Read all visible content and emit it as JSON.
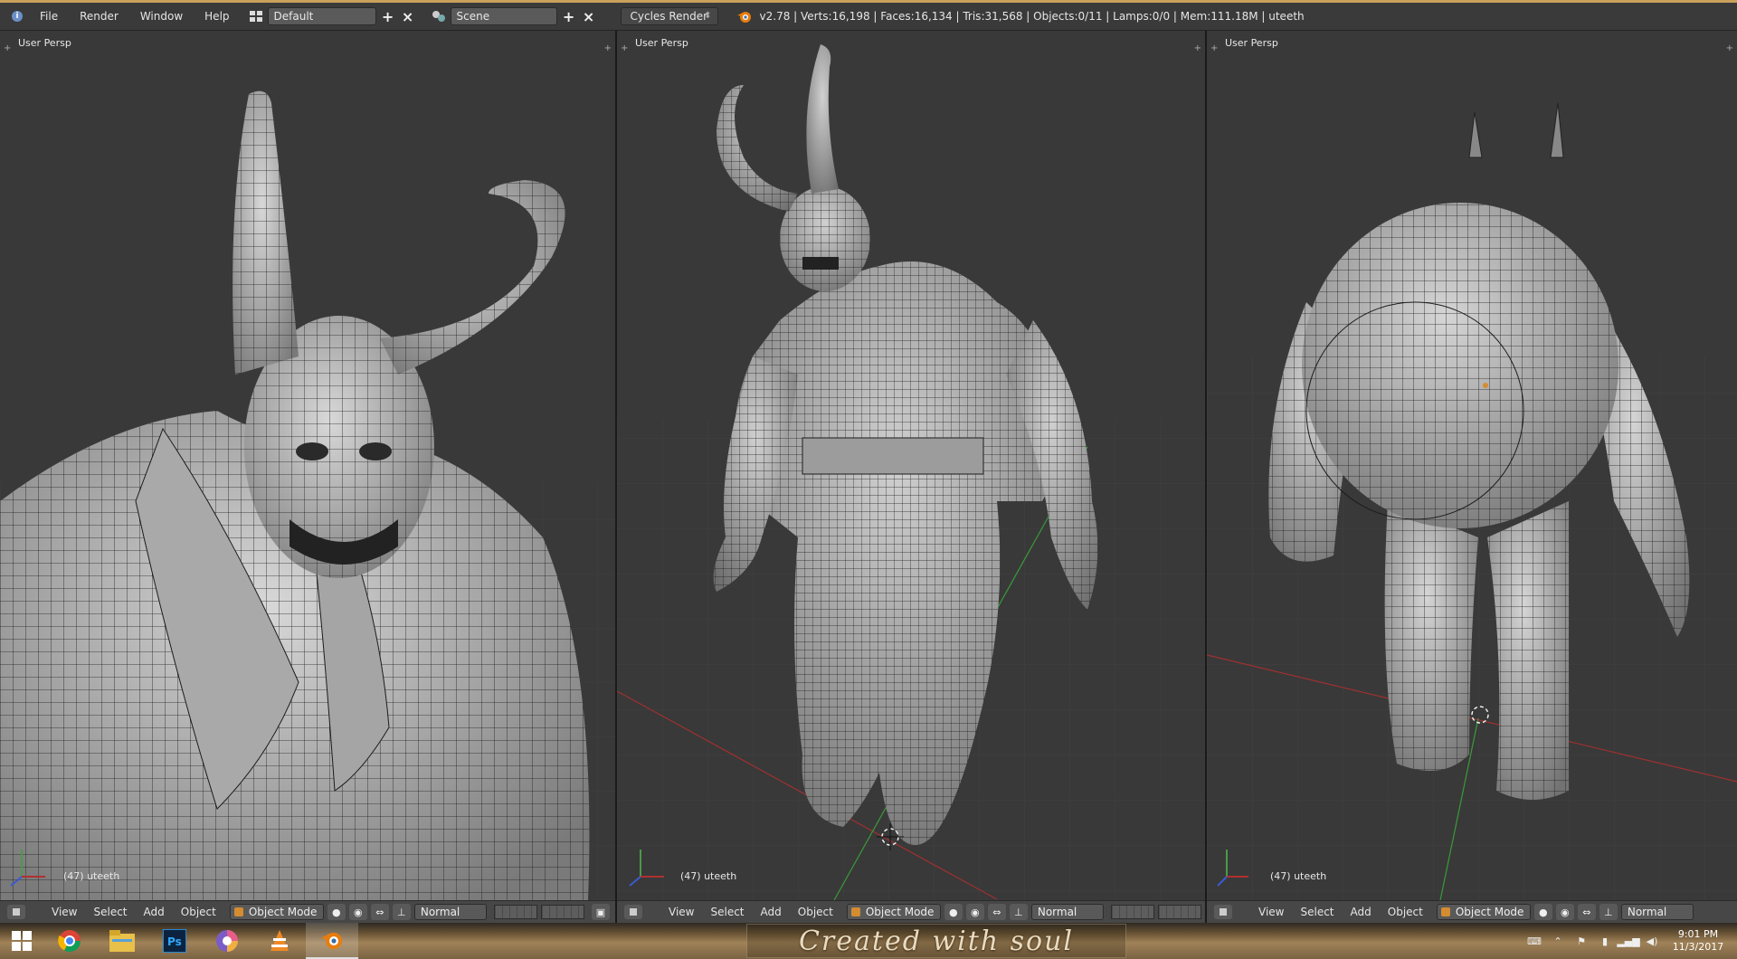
{
  "header": {
    "menus": [
      "File",
      "Render",
      "Window",
      "Help"
    ],
    "layout_name": "Default",
    "scene_name": "Scene",
    "render_engine": "Cycles Render",
    "stats": "v2.78 | Verts:16,198 | Faces:16,134 | Tris:31,568 | Objects:0/11 | Lamps:0/0 | Mem:111.18M | uteeth"
  },
  "viewports": [
    {
      "label": "User Persp",
      "object_info": "(47) uteeth",
      "footer": {
        "menus": [
          "View",
          "Select",
          "Add",
          "Object"
        ],
        "mode": "Object Mode",
        "pivot": "Normal"
      }
    },
    {
      "label": "User Persp",
      "object_info": "(47) uteeth",
      "footer": {
        "menus": [
          "View",
          "Select",
          "Add",
          "Object"
        ],
        "mode": "Object Mode",
        "pivot": "Normal"
      }
    },
    {
      "label": "User Persp",
      "object_info": "(47) uteeth",
      "footer": {
        "menus": [
          "View",
          "Select",
          "Add",
          "Object"
        ],
        "mode": "Object Mode",
        "pivot": "Normal"
      }
    }
  ],
  "taskbar": {
    "apps": [
      "windows-start-icon",
      "chrome-icon",
      "file-explorer-icon",
      "photoshop-icon",
      "color-app-icon",
      "vlc-icon",
      "blender-icon"
    ],
    "banner": "Created with soul",
    "clock_time": "9:01 PM",
    "clock_date": "11/3/2017"
  },
  "colors": {
    "viewport_bg": "#393939",
    "header_bg": "#3a3a3a",
    "accent_border": "#c9a15b",
    "mesh_fill": "#b5b5b5",
    "x_axis": "#b03030",
    "y_axis": "#3a9a3a"
  }
}
